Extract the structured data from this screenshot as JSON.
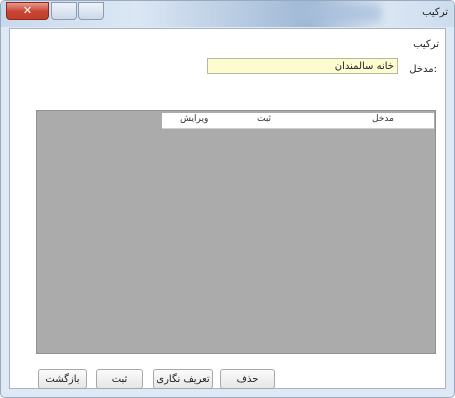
{
  "window": {
    "title": "ترکیب",
    "close_glyph": "✕"
  },
  "form": {
    "section_label": "ترکیب",
    "entry_label": "مدخل:",
    "entry_value": "خانه سالمندان"
  },
  "grid": {
    "columns": [
      "ویرایش",
      "ثبت",
      "مدخل"
    ]
  },
  "buttons": {
    "back": "بازگشت",
    "register": "ثبت",
    "define": "تعریف نگاری",
    "delete": "حذف"
  }
}
